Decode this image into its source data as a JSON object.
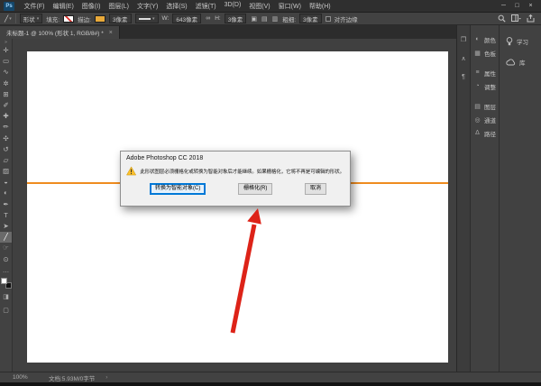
{
  "colors": {
    "shape-orange": "#ef8c1f",
    "stroke-swatch": "#e8a93a",
    "arrow-red": "#dd2318",
    "focus-blue": "#0078d7"
  },
  "menubar": {
    "logo": "Ps",
    "items": [
      "文件(F)",
      "编辑(E)",
      "图像(I)",
      "图层(L)",
      "文字(Y)",
      "选择(S)",
      "滤镜(T)",
      "3D(D)",
      "视图(V)",
      "窗口(W)",
      "帮助(H)"
    ],
    "window_controls": [
      {
        "name": "minimize-button",
        "glyph": "─"
      },
      {
        "name": "maximize-button",
        "glyph": "□"
      },
      {
        "name": "close-button",
        "glyph": "×"
      }
    ]
  },
  "options_bar": {
    "tool_icon_glyph": "╱",
    "dropdown_arrow": "▾",
    "mode_value": "形状",
    "fill_label": "填充:",
    "stroke_label": "描边:",
    "stroke_width_value": "3像素",
    "w_label": "W:",
    "w_value": "643像素",
    "link_glyph": "∞",
    "h_label": "H:",
    "h_value": "3像素",
    "path_op_icons": [
      {
        "name": "path-operations-icon",
        "glyph": "▣"
      },
      {
        "name": "path-alignment-icon",
        "glyph": "▤"
      },
      {
        "name": "path-arrangement-icon",
        "glyph": "▥"
      }
    ],
    "weight_label": "粗细:",
    "weight_value": "3像素",
    "align_edges_label": "对齐边缘"
  },
  "tabbar": {
    "title": "未标题-1 @ 100% (形状 1, RGB/8#) *",
    "close_glyph": "×"
  },
  "toolbar": {
    "collapse_glyph": "»",
    "tools": [
      {
        "name": "move-tool",
        "glyph": "✛"
      },
      {
        "name": "marquee-tool",
        "glyph": "▭"
      },
      {
        "name": "lasso-tool",
        "glyph": "∿"
      },
      {
        "name": "quick-select-tool",
        "glyph": "✲"
      },
      {
        "name": "crop-tool",
        "glyph": "⊞"
      },
      {
        "name": "eyedropper-tool",
        "glyph": "✐"
      },
      {
        "name": "healing-brush-tool",
        "glyph": "✚"
      },
      {
        "name": "brush-tool",
        "glyph": "✏"
      },
      {
        "name": "clone-stamp-tool",
        "glyph": "✣"
      },
      {
        "name": "history-brush-tool",
        "glyph": "↺"
      },
      {
        "name": "eraser-tool",
        "glyph": "▱"
      },
      {
        "name": "gradient-tool",
        "glyph": "▨"
      },
      {
        "name": "blur-tool",
        "glyph": "◒"
      },
      {
        "name": "dodge-tool",
        "glyph": "◐"
      },
      {
        "name": "pen-tool",
        "glyph": "✒"
      },
      {
        "name": "type-tool",
        "glyph": "T"
      },
      {
        "name": "path-select-tool",
        "glyph": "➤"
      },
      {
        "name": "line-tool",
        "glyph": "╱",
        "selected": true
      },
      {
        "name": "hand-tool",
        "glyph": "☞"
      },
      {
        "name": "zoom-tool",
        "glyph": "⊙"
      },
      {
        "name": "more-tools",
        "glyph": "…"
      }
    ],
    "quick_mask_glyph": "◨",
    "screen_mode_glyph": "▢"
  },
  "dialog": {
    "title": "Adobe Photoshop CC 2018",
    "message": "此形状图层必须栅格化或转换为智能对象后才能继续。如果栅格化，它将不再是可编辑的形状。",
    "buttons": [
      {
        "name": "convert-to-smart-object-button",
        "label": "转换为智能对象(C)",
        "focused": true
      },
      {
        "name": "rasterize-button",
        "label": "栅格化(R)",
        "focused": false
      },
      {
        "name": "cancel-button",
        "label": "取消",
        "focused": false
      }
    ]
  },
  "panels": {
    "col_a": [
      {
        "name": "collapsed-panel-icon-1",
        "glyph": "❐"
      },
      {
        "name": "collapsed-panel-icon-2",
        "glyph": "∧"
      },
      {
        "name": "collapsed-panel-icon-3",
        "glyph": "¶"
      }
    ],
    "col_b_groups": {
      "g1": [
        {
          "label": "颜色",
          "glyph": "◐"
        },
        {
          "label": "色板",
          "glyph": "▦"
        }
      ],
      "g2": [
        {
          "label": "属性",
          "glyph": "≡"
        },
        {
          "label": "调整",
          "glyph": "◔"
        }
      ],
      "g3": [
        {
          "label": "图层",
          "glyph": "▤"
        },
        {
          "label": "通道",
          "glyph": "◎"
        },
        {
          "label": "路径",
          "glyph": "Δ"
        }
      ]
    },
    "col_c": [
      {
        "label": "学习"
      },
      {
        "label": "库"
      }
    ]
  },
  "statusbar": {
    "zoom": "100%",
    "doc_info": "文档:5.93M/0字节",
    "chevron": "›"
  }
}
